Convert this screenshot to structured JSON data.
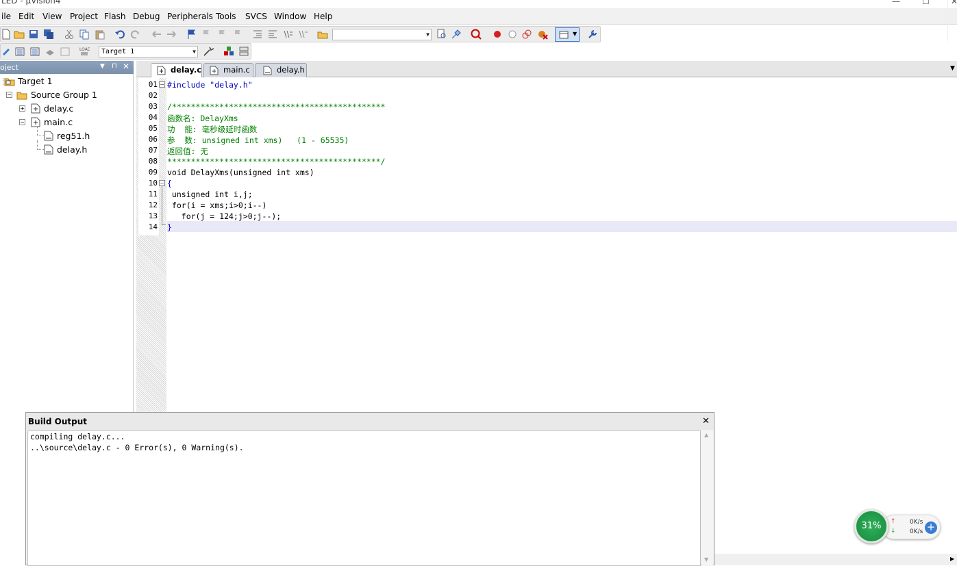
{
  "window": {
    "title": "LED - µVision4"
  },
  "menu": [
    "ile",
    "Edit",
    "View",
    "Project",
    "Flash",
    "Debug",
    "Peripherals",
    "Tools",
    "SVCS",
    "Window",
    "Help"
  ],
  "toolbar": {
    "build_target": "Target 1"
  },
  "project_panel": {
    "title": "oject",
    "tree": [
      {
        "label": "Target 1",
        "icon": "target-folder-icon"
      },
      {
        "label": "Source Group 1",
        "icon": "group-folder-icon"
      },
      {
        "label": "delay.c",
        "icon": "c-file-icon"
      },
      {
        "label": "main.c",
        "icon": "c-file-icon"
      },
      {
        "label": "reg51.h",
        "icon": "h-file-icon"
      },
      {
        "label": "delay.h",
        "icon": "h-file-icon"
      }
    ]
  },
  "tabs": [
    {
      "label": "delay.c",
      "active": true
    },
    {
      "label": "main.c",
      "active": false
    },
    {
      "label": "delay.h",
      "active": false
    }
  ],
  "editor": {
    "line_numbers": [
      "01",
      "02",
      "03",
      "04",
      "05",
      "06",
      "07",
      "08",
      "09",
      "10",
      "11",
      "12",
      "13",
      "14"
    ],
    "lines": [
      "#include \"delay.h\"",
      "",
      "/*********************************************",
      "函数名: DelayXms",
      "功  能: 毫秒级延时函数",
      "参  数: unsigned int xms)   (1 - 65535)",
      "返回值: 无",
      "*********************************************/",
      "void DelayXms(unsigned int xms)",
      "{",
      " unsigned int i,j;",
      " for(i = xms;i>0;i--)",
      "   for(j = 124;j>0;j--);",
      "}"
    ]
  },
  "build_output": {
    "title": "Build Output",
    "lines": [
      "compiling delay.c...",
      "..\\source\\delay.c - 0 Error(s), 0 Warning(s)."
    ]
  },
  "net_monitor": {
    "percent": "31%",
    "up": "0K/s",
    "down": "0K/s"
  }
}
